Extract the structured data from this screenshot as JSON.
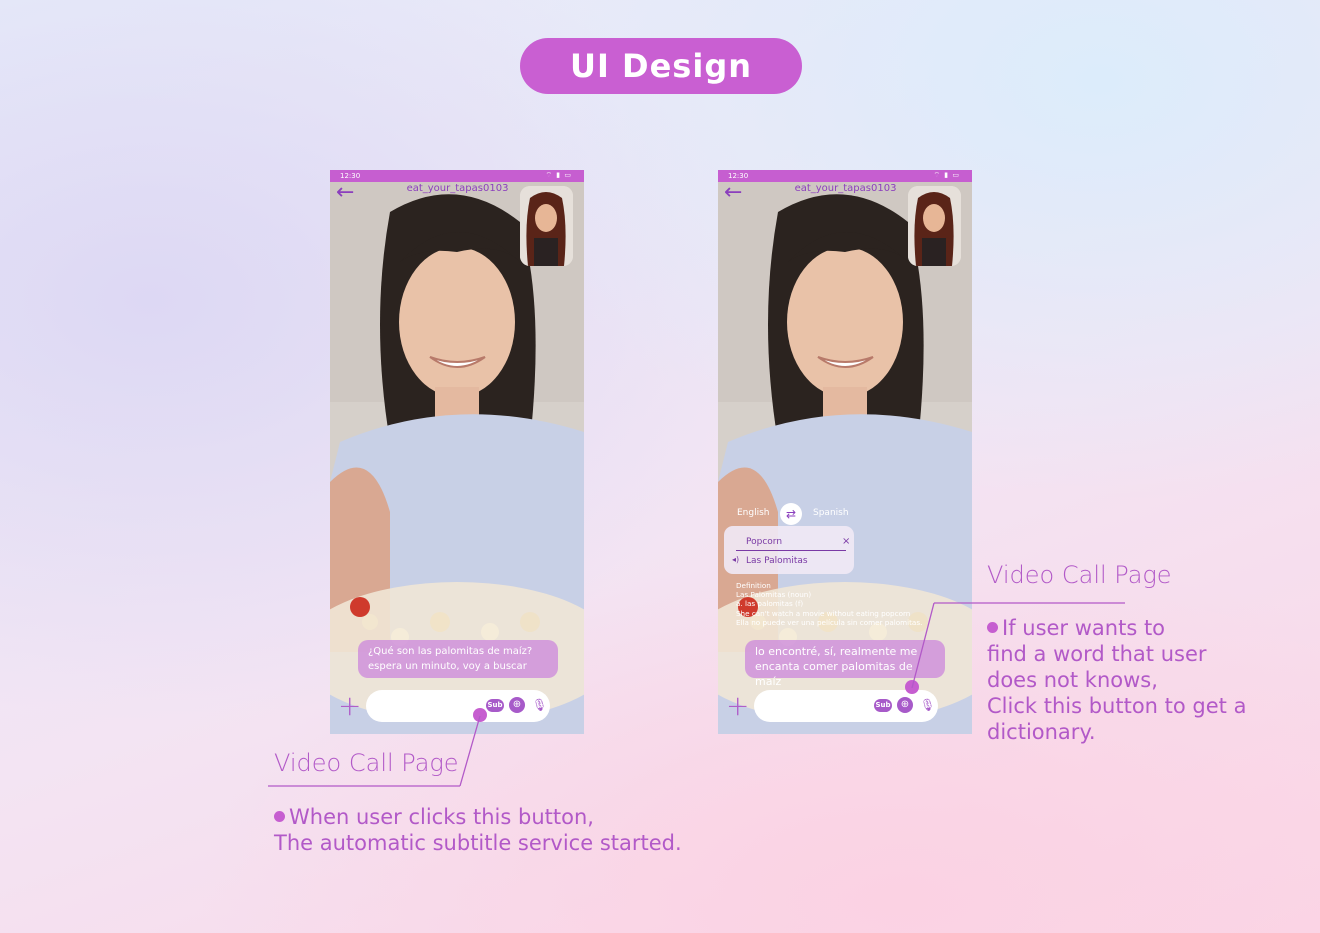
{
  "header": {
    "title": "UI Design"
  },
  "phones": {
    "left": {
      "status_time": "12:30",
      "username": "eat_your_tapas0103",
      "subtitle_lines": [
        "¿Qué son las palomitas de maíz?",
        "espera un minuto, voy a buscar"
      ],
      "sub_label": "Sub"
    },
    "right": {
      "status_time": "12:30",
      "username": "eat_your_tapas0103",
      "lang_from": "English",
      "lang_to": "Spanish",
      "dictionary_word": "Popcorn",
      "dictionary_translation": "Las Palomitas",
      "definition_lines": [
        "Definition",
        "Las Palomitas (noun)",
        "a. las palomitas (f)",
        "She can't watch a movie without eating popcorn",
        "Ella no puede ver una película sin comer palomitas."
      ],
      "subtitle_lines": [
        "lo encontré, sí, realmente me",
        "encanta comer palomitas de maíz"
      ],
      "sub_label": "Sub"
    }
  },
  "annotations": {
    "left": {
      "title": "Video Call Page",
      "lines": [
        "When user clicks this button,",
        "The automatic subtitle service started."
      ]
    },
    "right": {
      "title": "Video Call Page",
      "lines": [
        "If user wants to",
        "find a word that user",
        "does not knows,",
        "Click this button to get a",
        "dictionary."
      ]
    }
  },
  "colors": {
    "accent": "#c65ed0",
    "accent_dark": "#8b3fbd",
    "annotation": "#b259c8"
  },
  "icons": [
    "back-arrow-icon",
    "wifi-icon",
    "signal-icon",
    "battery-icon",
    "plus-icon",
    "subtitle-icon",
    "globe-icon",
    "microphone-icon",
    "swap-icon",
    "close-icon",
    "speaker-icon"
  ]
}
